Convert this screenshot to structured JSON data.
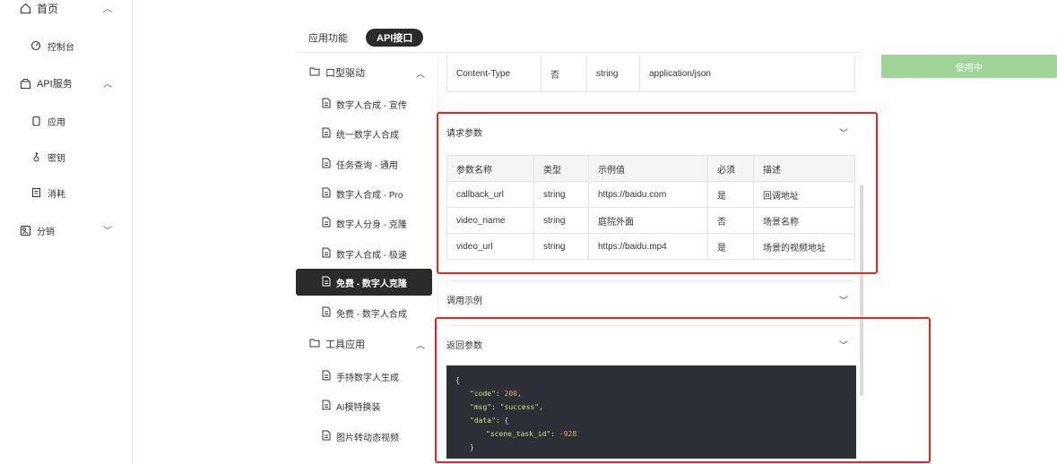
{
  "sidebar": {
    "items": [
      {
        "label": "首页",
        "icon": "home-icon",
        "expanded": true
      },
      {
        "label": "控制台",
        "icon": "dashboard-icon"
      },
      {
        "label": "API服务",
        "icon": "box-icon",
        "expanded": true
      },
      {
        "label": "应用",
        "icon": "app-icon"
      },
      {
        "label": "密钥",
        "icon": "key-icon"
      },
      {
        "label": "消耗",
        "icon": "receipt-icon"
      },
      {
        "label": "分销",
        "icon": "share-icon",
        "expanded": false
      }
    ]
  },
  "tabs": [
    {
      "label": "应用功能",
      "active": false
    },
    {
      "label": "API接口",
      "active": true
    }
  ],
  "nav": {
    "group1": "口型驱动",
    "group1_items": [
      "数字人合成 - 宣传",
      "统一数字人合成",
      "任务查询 - 通用",
      "数字人合成 - Pro",
      "数字人分身 - 克隆",
      "数字人合成 - 极速",
      "免费 - 数字人克隆",
      "免费 - 数字人合成"
    ],
    "active_item": "免费 - 数字人克隆",
    "group2": "工具应用",
    "group2_items": [
      "手持数字人生成",
      "AI模特换装",
      "图片转动态视频"
    ]
  },
  "header_table": {
    "row": [
      "Content-Type",
      "否",
      "string",
      "application/json"
    ]
  },
  "request_params": {
    "title": "请求参数",
    "columns": [
      "参数名称",
      "类型",
      "示例值",
      "必须",
      "描述"
    ],
    "rows": [
      [
        "callback_url",
        "string",
        "https://baidu.com",
        "是",
        "回调地址"
      ],
      [
        "video_name",
        "string",
        "庭院外面",
        "否",
        "场景名称"
      ],
      [
        "video_url",
        "string",
        "https://baidu.mp4",
        "是",
        "场景的视频地址"
      ]
    ]
  },
  "call_example": {
    "title": "调用示例"
  },
  "return_params": {
    "title": "返回参数",
    "code": {
      "open": "{",
      "code_key": "\"code\"",
      "code_val": "200",
      "msg_key": "\"msg\"",
      "msg_val": "\"success\"",
      "data_key": "\"data\"",
      "scene_key": "\"scene_task_id\"",
      "scene_val": "-928",
      "close_inner": "}"
    }
  },
  "use_button": {
    "label": "使用中"
  },
  "colors": {
    "accent": "#2b2b2b",
    "highlight": "#e8251f",
    "use_button": "#9fd697",
    "code_bg": "#2b2f36"
  }
}
